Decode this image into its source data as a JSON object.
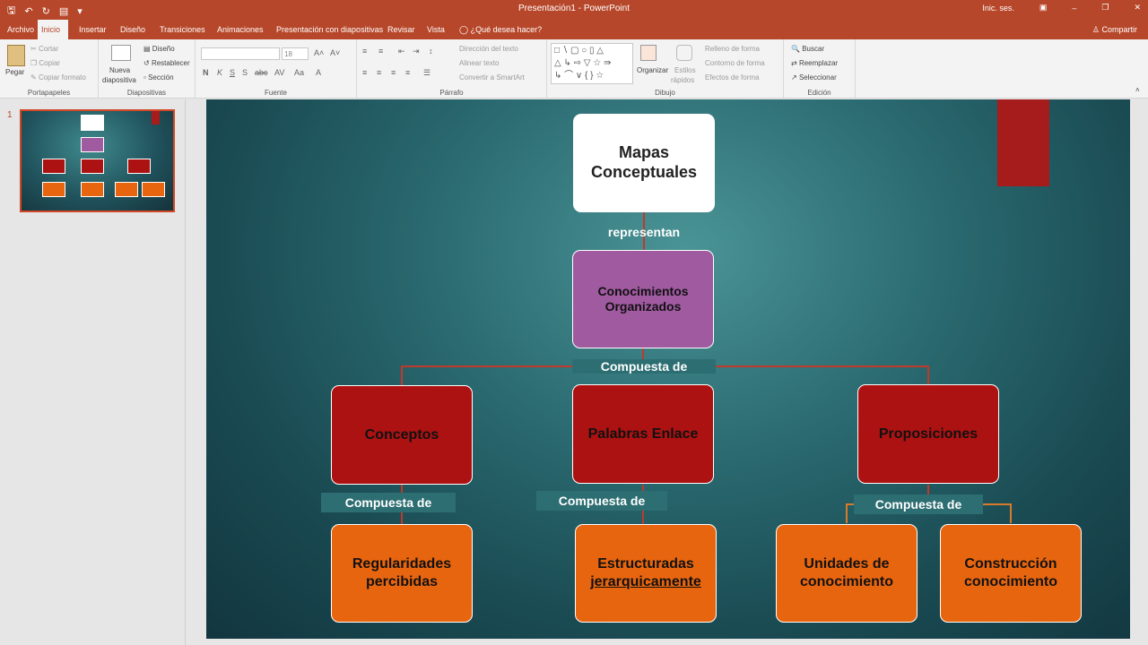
{
  "app": {
    "title": "Presentación1 - PowerPoint",
    "signin": "Inic. ses.",
    "share": "Compartir",
    "tell_me": "¿Qué desea hacer?"
  },
  "tabs": [
    "Archivo",
    "Inicio",
    "Insertar",
    "Diseño",
    "Transiciones",
    "Animaciones",
    "Presentación con diapositivas",
    "Revisar",
    "Vista"
  ],
  "ribbon": {
    "portapapeles": {
      "label": "Portapapeles",
      "pegar": "Pegar",
      "cortar": "Cortar",
      "copiar": "Copiar",
      "copiar_formato": "Copiar formato"
    },
    "diapositivas": {
      "label": "Diapositivas",
      "nueva": "Nueva",
      "diapositiva": "diapositiva",
      "diseno": "Diseño",
      "restablecer": "Restablecer",
      "seccion": "Sección"
    },
    "fuente": {
      "label": "Fuente",
      "size": "18"
    },
    "parrafo": {
      "label": "Párrafo",
      "direccion": "Dirección del texto",
      "alinear": "Alinear texto",
      "smartart": "Convertir a SmartArt"
    },
    "dibujo": {
      "label": "Dibujo",
      "organizar": "Organizar",
      "estilos": "Estilos",
      "rapidos": "rápidos",
      "relleno": "Relleno de forma",
      "contorno": "Contorno de forma",
      "efectos": "Efectos de forma"
    },
    "edicion": {
      "label": "Edición",
      "buscar": "Buscar",
      "reemplazar": "Reemplazar",
      "seleccionar": "Seleccionar"
    }
  },
  "slide_panel": {
    "number": "1"
  },
  "diagram": {
    "root": {
      "line1": "Mapas",
      "line2": "Conceptuales"
    },
    "edge_root": "representan",
    "middle": {
      "line1": "Conocimientos",
      "line2": "Organizados"
    },
    "edge_middle": "Compuesta de",
    "level2": [
      {
        "text": "Conceptos"
      },
      {
        "text": "Palabras Enlace"
      },
      {
        "text": "Proposiciones"
      }
    ],
    "edges_level2": [
      "Compuesta de",
      "Compuesta de",
      "Compuesta de"
    ],
    "level3": [
      {
        "line1": "Regularidades",
        "line2": "percibidas"
      },
      {
        "line1": "Estructuradas",
        "line2": "jerarquicamente"
      },
      {
        "line1": "Unidades de",
        "line2": "conocimiento"
      },
      {
        "line1": "Construcción",
        "line2": "conocimiento"
      }
    ]
  },
  "colors": {
    "accent": "#b7472a",
    "root": "#ffffff",
    "middle": "#a05aa0",
    "level2": "#ad1212",
    "level3": "#e8650f",
    "connector": "#c0392b",
    "slide_bg": "#2a6a70"
  }
}
